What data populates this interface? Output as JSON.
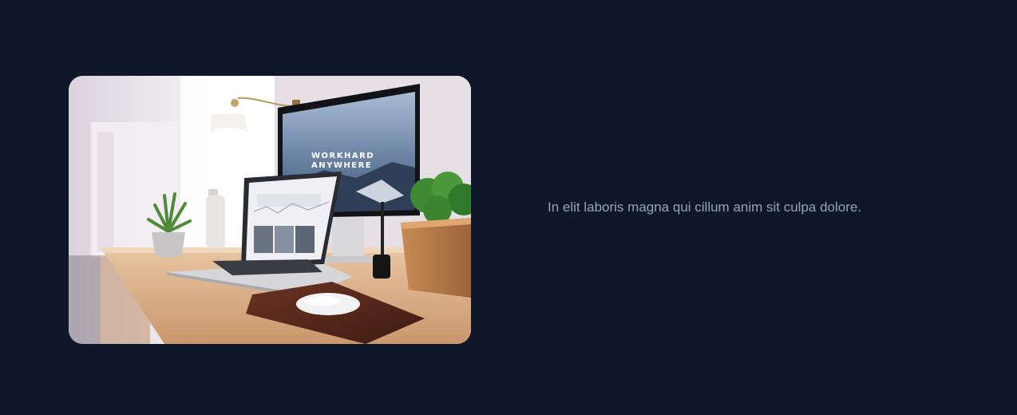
{
  "feature": {
    "image": {
      "alt_subject": "desk-workspace-photo",
      "screen_headline_line1": "WORKHARD",
      "screen_headline_line2": "ANYWHERE"
    },
    "text": "In elit laboris magna qui cillum anim sit culpa dolore."
  },
  "colors": {
    "page_background": "#0f172a",
    "body_text": "#94a3b8"
  }
}
